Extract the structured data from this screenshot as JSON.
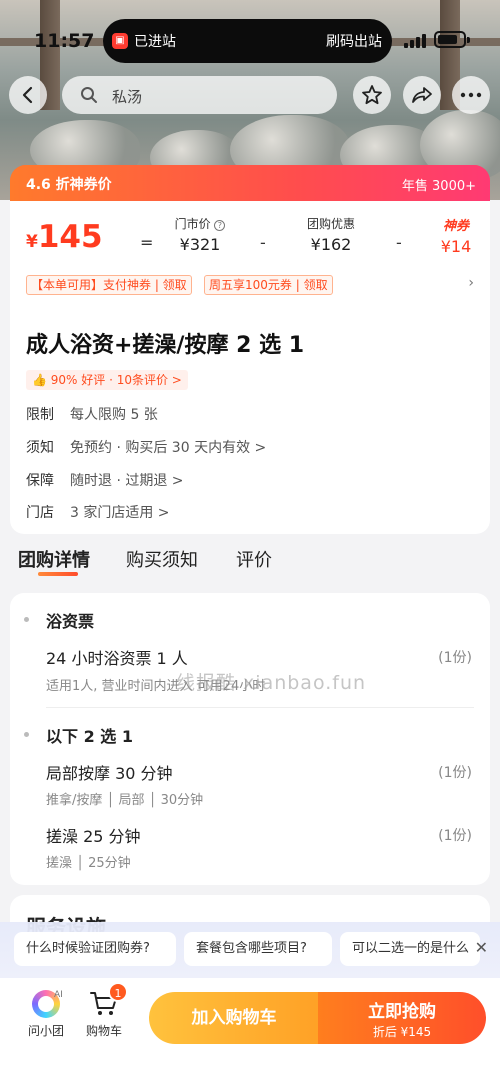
{
  "status_bar": {
    "time": "11:57",
    "island_left": "已进站",
    "island_right": "刷码出站"
  },
  "nav": {
    "search_text": "私汤"
  },
  "price_card": {
    "coupon_label": "4.6 折神券价",
    "sold": "年售 3000+",
    "currency": "¥",
    "price": "145",
    "eq": "=",
    "minus": "-",
    "market_label": "门市价",
    "market_value": "¥321",
    "group_label": "团购优惠",
    "group_value": "¥162",
    "god_label": "神券",
    "god_value": "¥14",
    "tag1": "【本单可用】支付神券 | 领取",
    "tag2": "周五享100元券 | 领取"
  },
  "info": {
    "title": "成人浴资+搓澡/按摩 2 选 1",
    "rating": "90% 好评 · 10条评价 >",
    "rows": [
      {
        "k": "限制",
        "v": "每人限购 5 张"
      },
      {
        "k": "须知",
        "v": "免预约 · 购买后 30 天内有效 >"
      },
      {
        "k": "保障",
        "v": "随时退 · 过期退 >"
      },
      {
        "k": "门店",
        "v": "3 家门店适用 >"
      }
    ]
  },
  "tabs": [
    "团购详情",
    "购买须知",
    "评价"
  ],
  "detail": {
    "section1": "浴资票",
    "item1_name": "24 小时浴资票 1 人",
    "item1_qty": "(1份)",
    "item1_sub": "适用1人, 营业时间内进入 可用24小时",
    "section2": "以下 2 选 1",
    "item2_name": "局部按摩 30 分钟",
    "item2_qty": "(1份)",
    "item2_sub": "推拿/按摩 │ 局部 │ 30分钟",
    "item3_name": "搓澡 25 分钟",
    "item3_qty": "(1份)",
    "item3_sub": "搓澡 │ 25分钟"
  },
  "watermark": "线报酷 xianbao.fun",
  "service_title": "服务设施",
  "suggestions": [
    "什么时候验证团购券?",
    "套餐包含哪些项目?",
    "可以二选一的是什么"
  ],
  "bottom": {
    "ai_label": "问小团",
    "ai_badge": "AI",
    "cart_label": "购物车",
    "cart_count": "1",
    "add_cart": "加入购物车",
    "buy": "立即抢购",
    "buy_sub": "折后 ¥145"
  },
  "colors": {
    "accent": "#ff4b2b",
    "orange": "#ffa126"
  }
}
